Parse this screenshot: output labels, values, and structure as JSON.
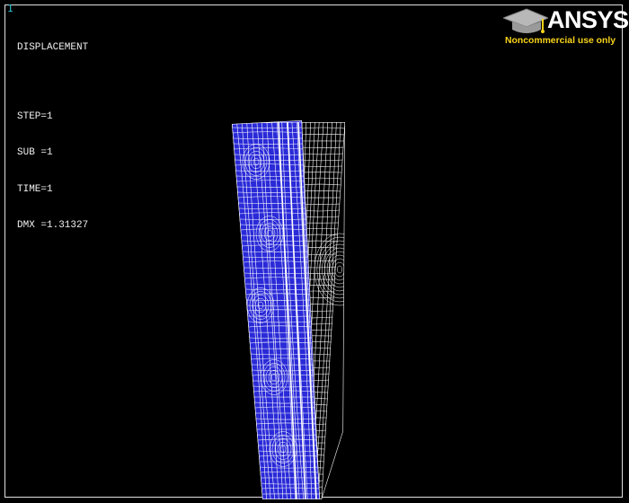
{
  "window": {
    "number": "1"
  },
  "result": {
    "title": "DISPLACEMENT",
    "step": "STEP=1",
    "sub": "SUB =1",
    "time": "TIME=1",
    "dmx": "DMX =1.31327"
  },
  "logo": {
    "brand": "ANSYS",
    "license": "Noncommercial use only",
    "icon": "graduation-cap-icon"
  },
  "colors": {
    "background": "#000000",
    "deformed_mesh": "#2a2ad8",
    "undeformed_mesh": "#ffffff",
    "text": "#f0f0f0",
    "window_number": "#30c8d8",
    "license_text": "#f7d31a"
  }
}
